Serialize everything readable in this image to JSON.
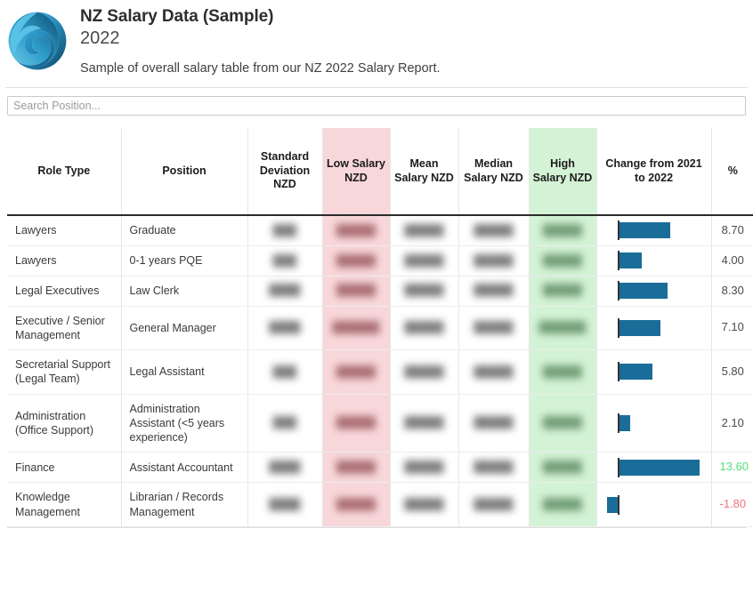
{
  "header": {
    "logo_icon": "spiral-swirl-logo",
    "title": "NZ Salary Data (Sample)",
    "year": "2022",
    "subtitle": "Sample of overall salary table from our NZ 2022 Salary Report."
  },
  "search": {
    "placeholder": "Search Position...",
    "value": ""
  },
  "table": {
    "columns": [
      {
        "key": "role_type",
        "label": "Role Type",
        "highlight": "none"
      },
      {
        "key": "position",
        "label": "Position",
        "highlight": "none"
      },
      {
        "key": "std_dev",
        "label": "Standard Deviation NZD",
        "highlight": "none"
      },
      {
        "key": "low_salary",
        "label": "Low Salary NZD",
        "highlight": "low"
      },
      {
        "key": "mean_salary",
        "label": "Mean Salary NZD",
        "highlight": "none"
      },
      {
        "key": "median_salary",
        "label": "Median Salary NZD",
        "highlight": "none"
      },
      {
        "key": "high_salary",
        "label": "High Salary NZD",
        "highlight": "high"
      },
      {
        "key": "change_bar",
        "label": "Change from 2021 to 2022",
        "highlight": "none"
      },
      {
        "key": "percent",
        "label": "%",
        "highlight": "none"
      }
    ],
    "redacted_placeholder": "█████",
    "rows": [
      {
        "role_type": "Lawyers",
        "position": "Graduate",
        "std_dev": "███",
        "low_salary": "█████",
        "mean_salary": "█████",
        "median_salary": "█████",
        "high_salary": "█████",
        "percent": "8.70",
        "percent_style": "normal"
      },
      {
        "role_type": "Lawyers",
        "position": "0-1 years PQE",
        "std_dev": "███",
        "low_salary": "█████",
        "mean_salary": "█████",
        "median_salary": "█████",
        "high_salary": "█████",
        "percent": "4.00",
        "percent_style": "normal"
      },
      {
        "role_type": "Legal Executives",
        "position": "Law Clerk",
        "std_dev": "████",
        "low_salary": "█████",
        "mean_salary": "█████",
        "median_salary": "█████",
        "high_salary": "█████",
        "percent": "8.30",
        "percent_style": "normal"
      },
      {
        "role_type": "Executive / Senior Management",
        "position": "General Manager",
        "std_dev": "████",
        "low_salary": "██████",
        "mean_salary": "█████",
        "median_salary": "█████",
        "high_salary": "██████",
        "percent": "7.10",
        "percent_style": "normal"
      },
      {
        "role_type": "Secretarial Support (Legal Team)",
        "position": "Legal Assistant",
        "std_dev": "███",
        "low_salary": "█████",
        "mean_salary": "█████",
        "median_salary": "█████",
        "high_salary": "█████",
        "percent": "5.80",
        "percent_style": "normal"
      },
      {
        "role_type": "Administration (Office Support)",
        "position": "Administration Assistant (<5 years experience)",
        "std_dev": "███",
        "low_salary": "█████",
        "mean_salary": "█████",
        "median_salary": "█████",
        "high_salary": "█████",
        "percent": "2.10",
        "percent_style": "normal"
      },
      {
        "role_type": "Finance",
        "position": "Assistant Accountant",
        "std_dev": "████",
        "low_salary": "█████",
        "mean_salary": "█████",
        "median_salary": "█████",
        "high_salary": "█████",
        "percent": "13.60",
        "percent_style": "positive-strong"
      },
      {
        "role_type": "Knowledge Management",
        "position": "Librarian / Records Management",
        "std_dev": "████",
        "low_salary": "█████",
        "mean_salary": "█████",
        "median_salary": "█████",
        "high_salary": "█████",
        "percent": "-1.80",
        "percent_style": "negative"
      }
    ]
  },
  "chart_data": {
    "type": "bar",
    "title": "Change from 2021 to 2022",
    "orientation": "horizontal",
    "xlabel": "%",
    "ylabel": "Position",
    "categories": [
      "Graduate",
      "0-1 years PQE",
      "Law Clerk",
      "General Manager",
      "Legal Assistant",
      "Administration Assistant (<5 years experience)",
      "Assistant Accountant",
      "Librarian / Records Management"
    ],
    "values": [
      8.7,
      4.0,
      8.3,
      7.1,
      5.8,
      2.1,
      13.6,
      -1.8
    ],
    "xlim": [
      -2.0,
      14.0
    ],
    "zero_line": 0,
    "grid": false,
    "legend": "none",
    "bar_color": "#1a6d99",
    "zero_line_color": "#333333",
    "positive_label_color": "#55e07a",
    "negative_label_color": "#f2707f",
    "neutral_label_color": "#4a4a4a"
  },
  "colors": {
    "low_salary_highlight": "#f8d7da",
    "high_salary_highlight": "#d4f3d6",
    "header_underline": "#2b2b2b",
    "bar": "#1a6d99",
    "logo_light": "#4fb6e0",
    "logo_dark": "#0d4f72"
  }
}
